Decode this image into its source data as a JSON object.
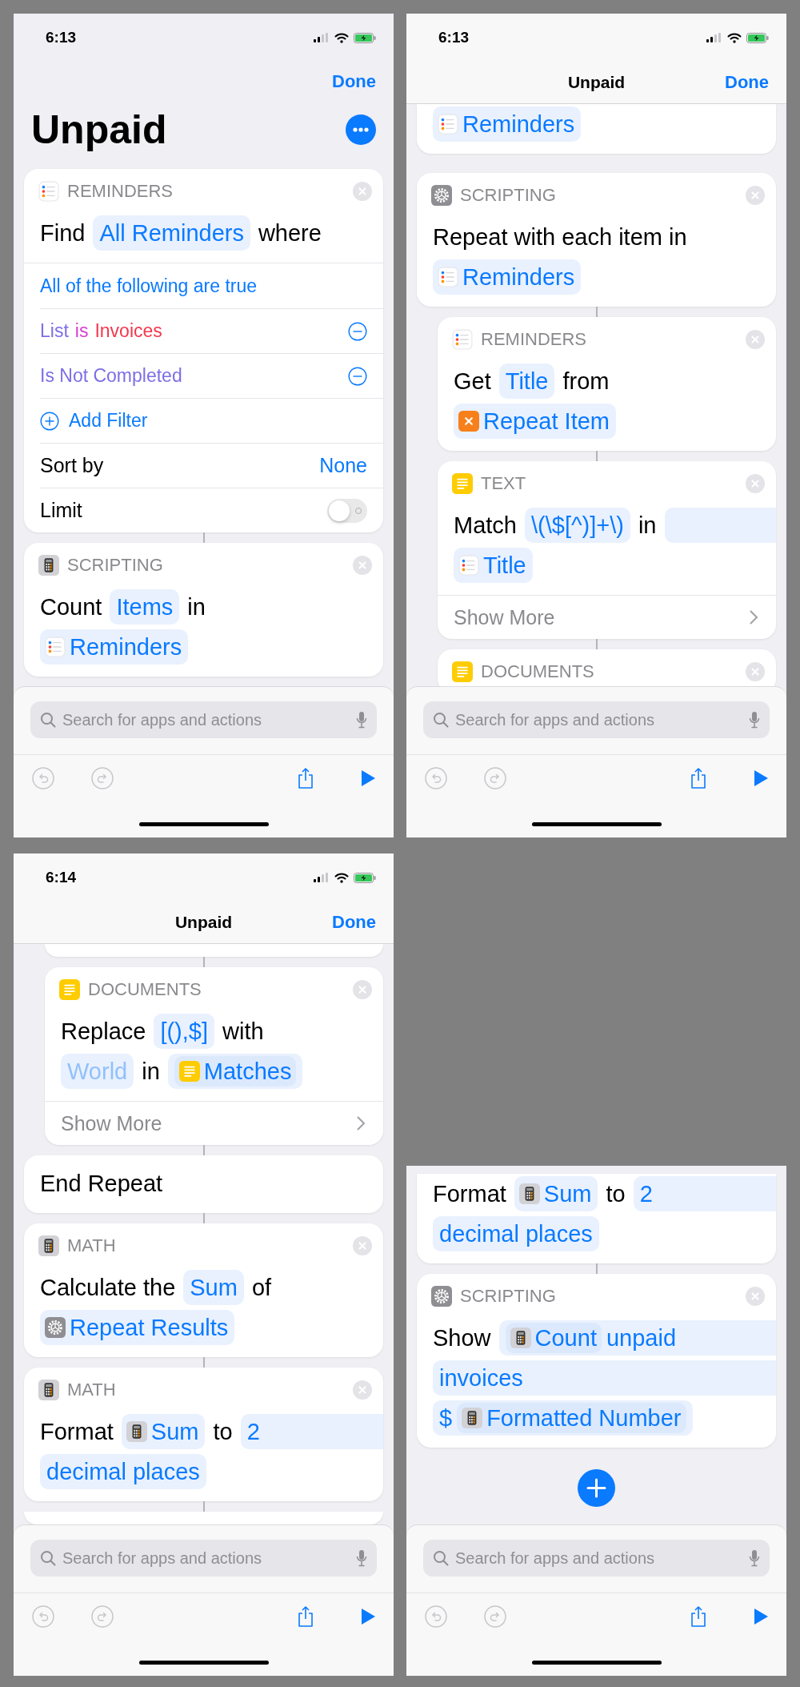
{
  "panels": [
    {
      "status": {
        "time": "6:13"
      },
      "header": {
        "kind": "large",
        "title": "Unpaid",
        "done": "Done"
      },
      "actions": [
        {
          "app": {
            "kind": "reminders",
            "label": "REMINDERS"
          },
          "lines": [
            [
              {
                "kind": "word",
                "text": "Find"
              },
              {
                "kind": "param",
                "text": "All Reminders"
              },
              {
                "kind": "word",
                "text": "where"
              }
            ]
          ],
          "rows": [
            {
              "kind": "link",
              "text": "All of the following are true"
            },
            {
              "kind": "filter",
              "parts": [
                {
                  "text": "List",
                  "color": "#7d6ee6"
                },
                {
                  "text": "is",
                  "color": "#d83fcf"
                },
                {
                  "text": "Invoices",
                  "color": "#f2384e"
                }
              ]
            },
            {
              "kind": "filter",
              "parts": [
                {
                  "text": "Is Not Completed",
                  "color": "#7d6ee6"
                }
              ]
            },
            {
              "kind": "add",
              "text": "Add Filter"
            },
            {
              "kind": "value",
              "label": "Sort by",
              "value": "None"
            },
            {
              "kind": "toggle",
              "label": "Limit",
              "on": false
            }
          ]
        },
        {
          "app": {
            "kind": "calculator",
            "label": "SCRIPTING"
          },
          "lines": [
            [
              {
                "kind": "word",
                "text": "Count"
              },
              {
                "kind": "param",
                "text": "Items"
              },
              {
                "kind": "word",
                "text": "in"
              }
            ],
            [
              {
                "kind": "var",
                "source": {
                  "kind": "reminders"
                },
                "text": "Reminders"
              }
            ]
          ]
        }
      ],
      "search": {
        "placeholder": "Search for apps and actions"
      },
      "toolbar": [
        {
          "kind": "undo",
          "disabled": true
        },
        {
          "kind": "redo",
          "disabled": true
        },
        {
          "kind": "share",
          "disabled": false
        },
        {
          "kind": "run",
          "disabled": false
        }
      ]
    },
    {
      "status": {
        "time": "6:13"
      },
      "header": {
        "kind": "compact",
        "title": "Unpaid",
        "done": "Done"
      },
      "actions": [
        {
          "cut": true,
          "lines": [
            [
              {
                "kind": "var",
                "source": {
                  "kind": "reminders"
                },
                "text": "Reminders"
              }
            ]
          ]
        },
        {
          "connected": false,
          "app": {
            "kind": "settings",
            "label": "SCRIPTING"
          },
          "lines": [
            [
              {
                "kind": "word",
                "text": "Repeat with each item in"
              }
            ],
            [
              {
                "kind": "var",
                "source": {
                  "kind": "reminders"
                },
                "text": "Reminders"
              }
            ]
          ]
        },
        {
          "indent": true,
          "app": {
            "kind": "reminders",
            "label": "REMINDERS"
          },
          "lines": [
            [
              {
                "kind": "word",
                "text": "Get"
              },
              {
                "kind": "param",
                "text": "Title"
              },
              {
                "kind": "word",
                "text": "from"
              }
            ],
            [
              {
                "kind": "var",
                "source": {
                  "kind": "variable"
                },
                "text": "Repeat Item"
              }
            ]
          ]
        },
        {
          "indent": true,
          "app": {
            "kind": "text",
            "label": "TEXT"
          },
          "lines": [
            [
              {
                "kind": "word",
                "text": "Match"
              },
              {
                "kind": "param",
                "text": "\\(\\$[^)]+\\)"
              },
              {
                "kind": "word",
                "text": "in"
              },
              {
                "kind": "band"
              }
            ],
            [
              {
                "kind": "var",
                "source": {
                  "kind": "reminders"
                },
                "text": "Title"
              }
            ]
          ],
          "show_more": "Show More"
        },
        {
          "indent": true,
          "app": {
            "kind": "text",
            "label": "DOCUMENTS"
          }
        }
      ],
      "search": {
        "placeholder": "Search for apps and actions"
      },
      "toolbar": [
        {
          "kind": "undo",
          "disabled": true
        },
        {
          "kind": "redo",
          "disabled": true
        },
        {
          "kind": "share",
          "disabled": false
        },
        {
          "kind": "run",
          "disabled": false
        }
      ]
    },
    {
      "status": {
        "time": "6:14"
      },
      "header": {
        "kind": "compact",
        "title": "Unpaid",
        "done": "Done"
      },
      "actions": [
        {
          "cut": true,
          "indent": true
        },
        {
          "indent": true,
          "app": {
            "kind": "text",
            "label": "DOCUMENTS"
          },
          "lines": [
            [
              {
                "kind": "word",
                "text": "Replace"
              },
              {
                "kind": "param",
                "text": "[(),$]"
              },
              {
                "kind": "word",
                "text": "with"
              }
            ],
            [
              {
                "kind": "param",
                "text": "World",
                "dim": true
              },
              {
                "kind": "word",
                "text": "in"
              },
              {
                "kind": "param",
                "parts": [
                  {
                    "kind": "var",
                    "source": {
                      "kind": "text"
                    },
                    "text": "Matches"
                  }
                ]
              }
            ]
          ],
          "show_more": "Show More"
        },
        {
          "lines": [
            [
              {
                "kind": "word",
                "text": "End Repeat"
              }
            ]
          ]
        },
        {
          "app": {
            "kind": "calculator",
            "label": "MATH"
          },
          "lines": [
            [
              {
                "kind": "word",
                "text": "Calculate the"
              },
              {
                "kind": "param",
                "text": "Sum"
              },
              {
                "kind": "word",
                "text": "of"
              }
            ],
            [
              {
                "kind": "var",
                "source": {
                  "kind": "settings"
                },
                "text": "Repeat Results"
              }
            ]
          ]
        },
        {
          "app": {
            "kind": "calculator",
            "label": "MATH"
          },
          "lines": [
            [
              {
                "kind": "word",
                "text": "Format"
              },
              {
                "kind": "var",
                "source": {
                  "kind": "calculator"
                },
                "text": "Sum"
              },
              {
                "kind": "word",
                "text": "to"
              },
              {
                "kind": "param",
                "text": "2",
                "fill": true
              }
            ],
            [
              {
                "kind": "param",
                "text": "decimal places"
              }
            ]
          ]
        },
        {
          "cut": true
        }
      ],
      "search": {
        "placeholder": "Search for apps and actions"
      },
      "toolbar": [
        {
          "kind": "undo",
          "disabled": true
        },
        {
          "kind": "redo",
          "disabled": true
        },
        {
          "kind": "share",
          "disabled": false
        },
        {
          "kind": "run",
          "disabled": false
        }
      ]
    },
    {
      "actions": [
        {
          "cut": true,
          "lines": [
            [
              {
                "kind": "word",
                "text": "Format"
              },
              {
                "kind": "var",
                "source": {
                  "kind": "calculator"
                },
                "text": "Sum"
              },
              {
                "kind": "word",
                "text": "to"
              },
              {
                "kind": "param",
                "text": "2",
                "fill": true
              }
            ],
            [
              {
                "kind": "param",
                "text": "decimal places"
              }
            ]
          ]
        },
        {
          "app": {
            "kind": "settings",
            "label": "SCRIPTING"
          },
          "lines": [
            [
              {
                "kind": "word",
                "text": "Show"
              },
              {
                "kind": "param",
                "fill": true,
                "parts": [
                  {
                    "kind": "var",
                    "source": {
                      "kind": "calculator"
                    },
                    "text": "Count"
                  },
                  {
                    "kind": "text",
                    "text": "unpaid"
                  }
                ]
              }
            ],
            [
              {
                "kind": "param",
                "fill": true,
                "text": "invoices"
              }
            ],
            [
              {
                "kind": "param",
                "parts": [
                  {
                    "kind": "text",
                    "text": "$"
                  },
                  {
                    "kind": "var",
                    "source": {
                      "kind": "calculator"
                    },
                    "text": "Formatted Number"
                  }
                ]
              }
            ]
          ]
        }
      ],
      "add_button": true,
      "search": {
        "placeholder": "Search for apps and actions"
      },
      "toolbar": [
        {
          "kind": "undo",
          "disabled": true
        },
        {
          "kind": "redo",
          "disabled": true
        },
        {
          "kind": "share",
          "disabled": false
        },
        {
          "kind": "run",
          "disabled": false
        }
      ]
    }
  ]
}
